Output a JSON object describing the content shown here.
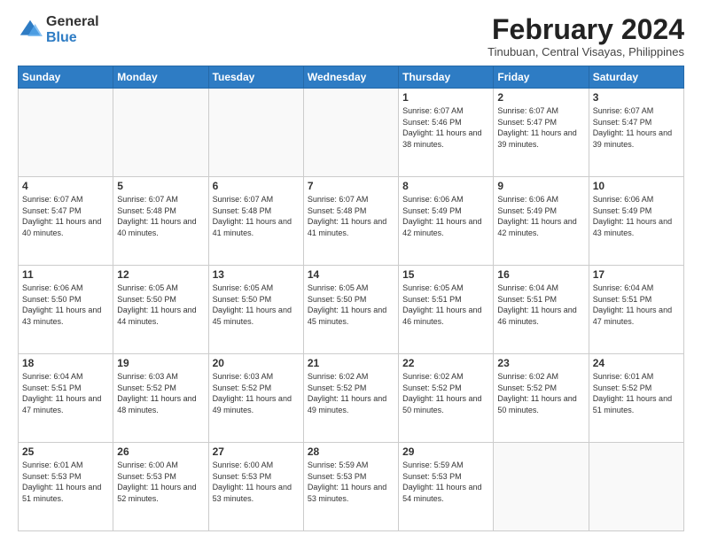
{
  "header": {
    "logo": {
      "general": "General",
      "blue": "Blue"
    },
    "title": "February 2024",
    "location": "Tinubuan, Central Visayas, Philippines"
  },
  "calendar": {
    "days_of_week": [
      "Sunday",
      "Monday",
      "Tuesday",
      "Wednesday",
      "Thursday",
      "Friday",
      "Saturday"
    ],
    "weeks": [
      {
        "cells": [
          {
            "day": "",
            "empty": true
          },
          {
            "day": "",
            "empty": true
          },
          {
            "day": "",
            "empty": true
          },
          {
            "day": "",
            "empty": true
          },
          {
            "day": "1",
            "sunrise": "6:07 AM",
            "sunset": "5:46 PM",
            "daylight": "11 hours and 38 minutes."
          },
          {
            "day": "2",
            "sunrise": "6:07 AM",
            "sunset": "5:47 PM",
            "daylight": "11 hours and 39 minutes."
          },
          {
            "day": "3",
            "sunrise": "6:07 AM",
            "sunset": "5:47 PM",
            "daylight": "11 hours and 39 minutes."
          }
        ]
      },
      {
        "cells": [
          {
            "day": "4",
            "sunrise": "6:07 AM",
            "sunset": "5:47 PM",
            "daylight": "11 hours and 40 minutes."
          },
          {
            "day": "5",
            "sunrise": "6:07 AM",
            "sunset": "5:48 PM",
            "daylight": "11 hours and 40 minutes."
          },
          {
            "day": "6",
            "sunrise": "6:07 AM",
            "sunset": "5:48 PM",
            "daylight": "11 hours and 41 minutes."
          },
          {
            "day": "7",
            "sunrise": "6:07 AM",
            "sunset": "5:48 PM",
            "daylight": "11 hours and 41 minutes."
          },
          {
            "day": "8",
            "sunrise": "6:06 AM",
            "sunset": "5:49 PM",
            "daylight": "11 hours and 42 minutes."
          },
          {
            "day": "9",
            "sunrise": "6:06 AM",
            "sunset": "5:49 PM",
            "daylight": "11 hours and 42 minutes."
          },
          {
            "day": "10",
            "sunrise": "6:06 AM",
            "sunset": "5:49 PM",
            "daylight": "11 hours and 43 minutes."
          }
        ]
      },
      {
        "cells": [
          {
            "day": "11",
            "sunrise": "6:06 AM",
            "sunset": "5:50 PM",
            "daylight": "11 hours and 43 minutes."
          },
          {
            "day": "12",
            "sunrise": "6:05 AM",
            "sunset": "5:50 PM",
            "daylight": "11 hours and 44 minutes."
          },
          {
            "day": "13",
            "sunrise": "6:05 AM",
            "sunset": "5:50 PM",
            "daylight": "11 hours and 45 minutes."
          },
          {
            "day": "14",
            "sunrise": "6:05 AM",
            "sunset": "5:50 PM",
            "daylight": "11 hours and 45 minutes."
          },
          {
            "day": "15",
            "sunrise": "6:05 AM",
            "sunset": "5:51 PM",
            "daylight": "11 hours and 46 minutes."
          },
          {
            "day": "16",
            "sunrise": "6:04 AM",
            "sunset": "5:51 PM",
            "daylight": "11 hours and 46 minutes."
          },
          {
            "day": "17",
            "sunrise": "6:04 AM",
            "sunset": "5:51 PM",
            "daylight": "11 hours and 47 minutes."
          }
        ]
      },
      {
        "cells": [
          {
            "day": "18",
            "sunrise": "6:04 AM",
            "sunset": "5:51 PM",
            "daylight": "11 hours and 47 minutes."
          },
          {
            "day": "19",
            "sunrise": "6:03 AM",
            "sunset": "5:52 PM",
            "daylight": "11 hours and 48 minutes."
          },
          {
            "day": "20",
            "sunrise": "6:03 AM",
            "sunset": "5:52 PM",
            "daylight": "11 hours and 49 minutes."
          },
          {
            "day": "21",
            "sunrise": "6:02 AM",
            "sunset": "5:52 PM",
            "daylight": "11 hours and 49 minutes."
          },
          {
            "day": "22",
            "sunrise": "6:02 AM",
            "sunset": "5:52 PM",
            "daylight": "11 hours and 50 minutes."
          },
          {
            "day": "23",
            "sunrise": "6:02 AM",
            "sunset": "5:52 PM",
            "daylight": "11 hours and 50 minutes."
          },
          {
            "day": "24",
            "sunrise": "6:01 AM",
            "sunset": "5:52 PM",
            "daylight": "11 hours and 51 minutes."
          }
        ]
      },
      {
        "cells": [
          {
            "day": "25",
            "sunrise": "6:01 AM",
            "sunset": "5:53 PM",
            "daylight": "11 hours and 51 minutes."
          },
          {
            "day": "26",
            "sunrise": "6:00 AM",
            "sunset": "5:53 PM",
            "daylight": "11 hours and 52 minutes."
          },
          {
            "day": "27",
            "sunrise": "6:00 AM",
            "sunset": "5:53 PM",
            "daylight": "11 hours and 53 minutes."
          },
          {
            "day": "28",
            "sunrise": "5:59 AM",
            "sunset": "5:53 PM",
            "daylight": "11 hours and 53 minutes."
          },
          {
            "day": "29",
            "sunrise": "5:59 AM",
            "sunset": "5:53 PM",
            "daylight": "11 hours and 54 minutes."
          },
          {
            "day": "",
            "empty": true
          },
          {
            "day": "",
            "empty": true
          }
        ]
      }
    ]
  }
}
